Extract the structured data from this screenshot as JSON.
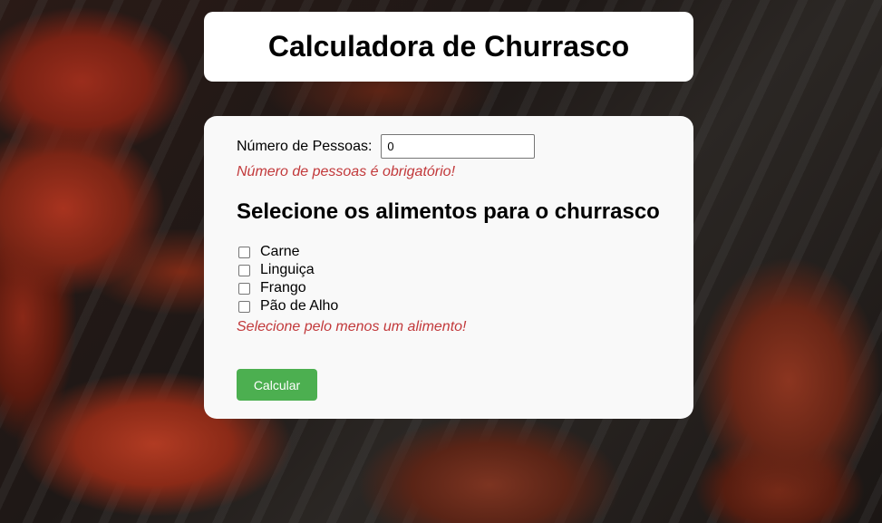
{
  "header": {
    "title": "Calculadora de Churrasco"
  },
  "form": {
    "people_label": "Número de Pessoas:",
    "people_value": "0",
    "people_error": "Número de pessoas é obrigatório!",
    "section_title": "Selecione os alimentos para o churrasco",
    "foods": [
      {
        "label": "Carne",
        "checked": false
      },
      {
        "label": "Linguiça",
        "checked": false
      },
      {
        "label": "Frango",
        "checked": false
      },
      {
        "label": "Pão de Alho",
        "checked": false
      }
    ],
    "food_error": "Selecione pelo menos um alimento!",
    "submit_label": "Calcular"
  },
  "colors": {
    "button": "#4caf50",
    "error": "#c2393b",
    "card": "#f9f9f9"
  }
}
